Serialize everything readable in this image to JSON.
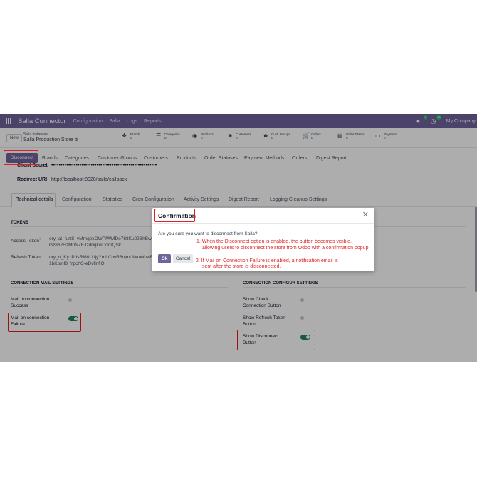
{
  "navbar": {
    "app_name": "Salla Connector",
    "menus": [
      "Configuration",
      "Salla",
      "Logs",
      "Reports"
    ],
    "company": "My Company",
    "chat_count": "7",
    "activity_count": "10"
  },
  "control": {
    "new_label": "New",
    "breadcrumb_parent": "Salla Instances",
    "breadcrumb_current": "Salla Production Store",
    "smart_buttons": [
      {
        "label": "Brands",
        "count": "0",
        "icon": "tags-icon"
      },
      {
        "label": "Categories",
        "count": "0",
        "icon": "list-icon"
      },
      {
        "label": "Products",
        "count": "0",
        "icon": "products-icon"
      },
      {
        "label": "Customers",
        "count": "0",
        "icon": "users-icon"
      },
      {
        "label": "Cust. Groups",
        "count": "0",
        "icon": "users-icon"
      },
      {
        "label": "Orders",
        "count": "0",
        "icon": "cart-icon"
      },
      {
        "label": "Order Status",
        "count": "0",
        "icon": "status-icon"
      },
      {
        "label": "Payment",
        "count": "0",
        "icon": "payment-icon"
      }
    ]
  },
  "tabs": {
    "disconnect_label": "Disconnect",
    "items": [
      "Brands",
      "Categories",
      "Customer Groups",
      "Customers",
      "Products",
      "Order Statuses",
      "Payment Methods",
      "Orders",
      "Digest Report"
    ]
  },
  "form": {
    "client_secret_label": "Client Secret",
    "client_secret_value": "••••••••••••••••••••••••••••••••••••••••••••••••••••••••",
    "redirect_label": "Redirect URI",
    "redirect_value": "http://localhost:8020/salla/callback",
    "subtabs": [
      "Technical details",
      "Configuration",
      "Statistics",
      "Cron Configuration",
      "Activity Settings",
      "Digest Report",
      "Logging Cleanup Settings"
    ],
    "tokens_title": "TOKENS",
    "access_token_label": "Access Token",
    "access_token_help": "?",
    "access_token_line1": "ory_at_furtS_yMmqekOWPfWMDo788Ku02BhBwk",
    "access_token_line2": "Gz862HzM0NZEJzd0qkwDoqrQSk",
    "refresh_token_label": "Refresh Token",
    "refresh_token_line1": "ory_rt_Ky1PdsRM0LUjyYmLCbvR6ujmUWuWuwE",
    "refresh_token_line2": "1bKbmf8_YpchC-eDvfinfjQ",
    "mail_title": "CONNECTION MAIL SETTINGS",
    "mail_success_label_1": "Mail on connection",
    "mail_success_label_2": "Success",
    "mail_success_value": false,
    "mail_failure_label_1": "Mail on connection",
    "mail_failure_label_2": "Failure",
    "mail_failure_value": true,
    "config_title": "CONNECTION CONFIGUR SETTINGS",
    "show_check_label_1": "Show Check",
    "show_check_label_2": "Connection Button",
    "show_check_value": false,
    "show_refresh_label_1": "Show Refresh Token",
    "show_refresh_label_2": "Button",
    "show_refresh_value": false,
    "show_disconnect_label_1": "Show Disconnect",
    "show_disconnect_label_2": "Button",
    "show_disconnect_value": true
  },
  "modal": {
    "title": "Confirmation",
    "body": "Are you sure you want to disconnect from Salla?",
    "ok_label": "Ok",
    "cancel_label": "Cancel",
    "close_icon": "close-icon"
  },
  "annotations": {
    "note1_line1": "1. When the Disconnect option is enabled, the button becomes visible,",
    "note1_line2": "allowing users to disconnect the store from Odoo with a confirmation popup.",
    "note2_line1": "2. If Mail on Connection Failure is enabled, a notification email is",
    "note2_line2": "sent after the store is disconnected.",
    "highlight_color": "#e11d1d"
  },
  "colors": {
    "brand": "#71639e",
    "toggle_on": "#218560"
  }
}
